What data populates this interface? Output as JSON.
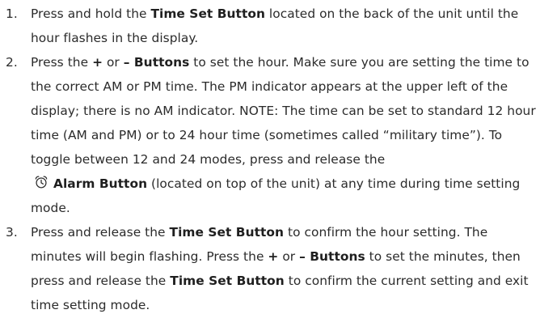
{
  "steps": [
    {
      "number": "1.",
      "parts": [
        "Press and hold the ",
        "Time Set Button",
        " located on the back of the unit until the hour flashes in the display."
      ]
    },
    {
      "number": "2.",
      "parts": [
        "Press the ",
        "+",
        " or ",
        "– Buttons",
        " to set the hour. Make sure you are setting the time to the correct AM or PM time. The PM indicator appears at the upper left of the display; there is no AM indicator.  NOTE: The time can be set to standard 12 hour time (AM and PM) or to 24 hour time (sometimes called “military time”). To toggle between 12 and 24 modes, press and release the",
        "Alarm Button",
        " (located on top of the unit) at any time during time setting mode."
      ],
      "icon": "alarm-clock-icon"
    },
    {
      "number": "3.",
      "parts": [
        "Press and release the ",
        "Time Set Button",
        " to confirm the hour setting. The minutes will begin flashing. Press the ",
        "+",
        " or ",
        "– Buttons",
        " to set the minutes, then press and release the ",
        "Time Set Button",
        " to confirm the current setting and exit time setting mode."
      ]
    }
  ]
}
